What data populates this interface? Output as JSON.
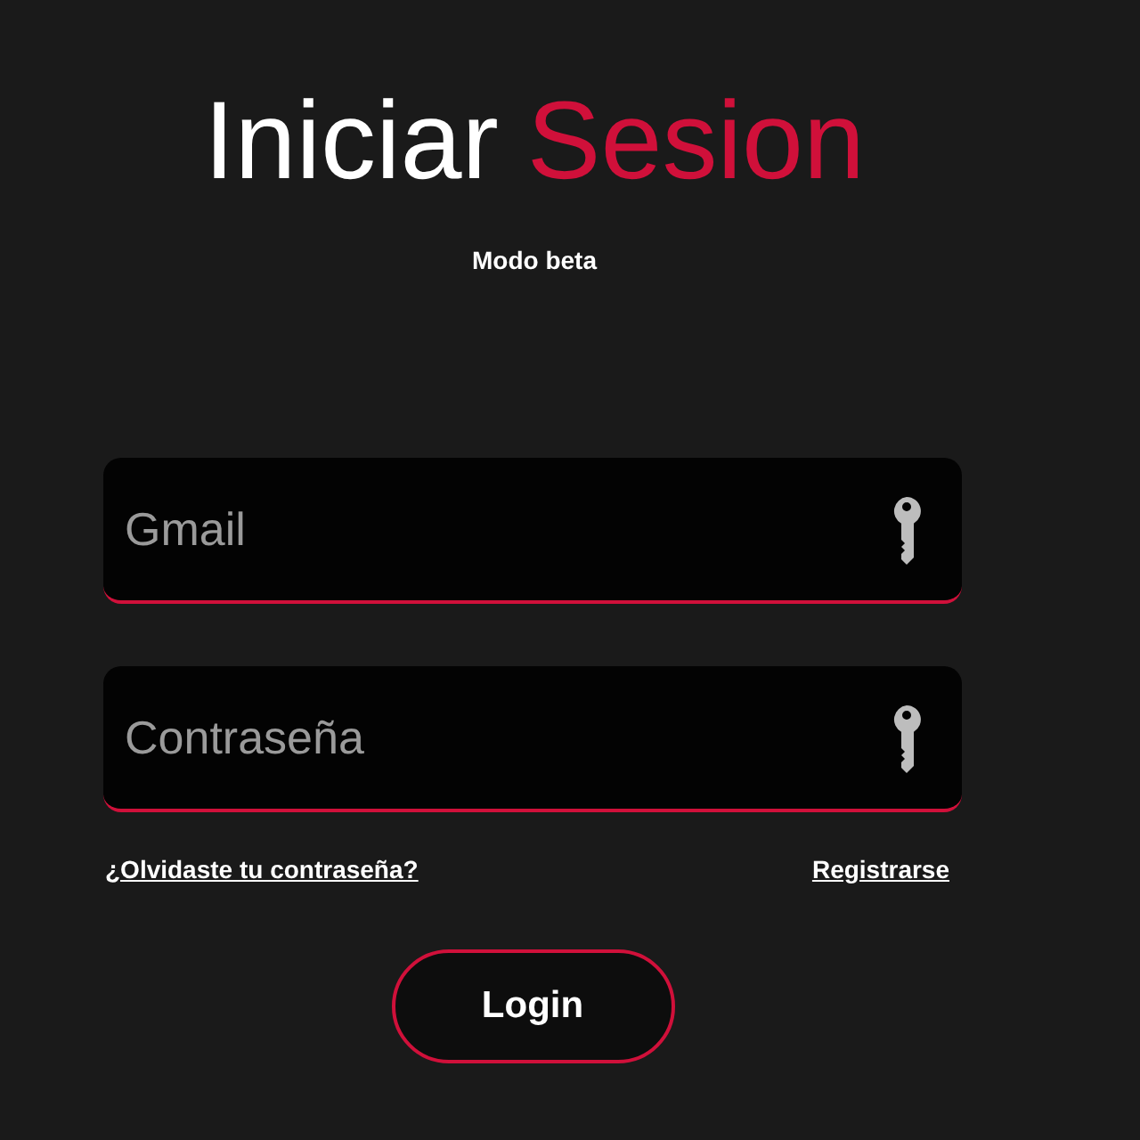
{
  "title": {
    "first": "Iniciar",
    "second": "Sesion"
  },
  "subtitle": "Modo beta",
  "fields": [
    {
      "placeholder": "Gmail"
    },
    {
      "placeholder": "Contraseña"
    }
  ],
  "links": [
    "¿Olvidaste tu contraseña?",
    "Registrarse"
  ],
  "button": "Login"
}
